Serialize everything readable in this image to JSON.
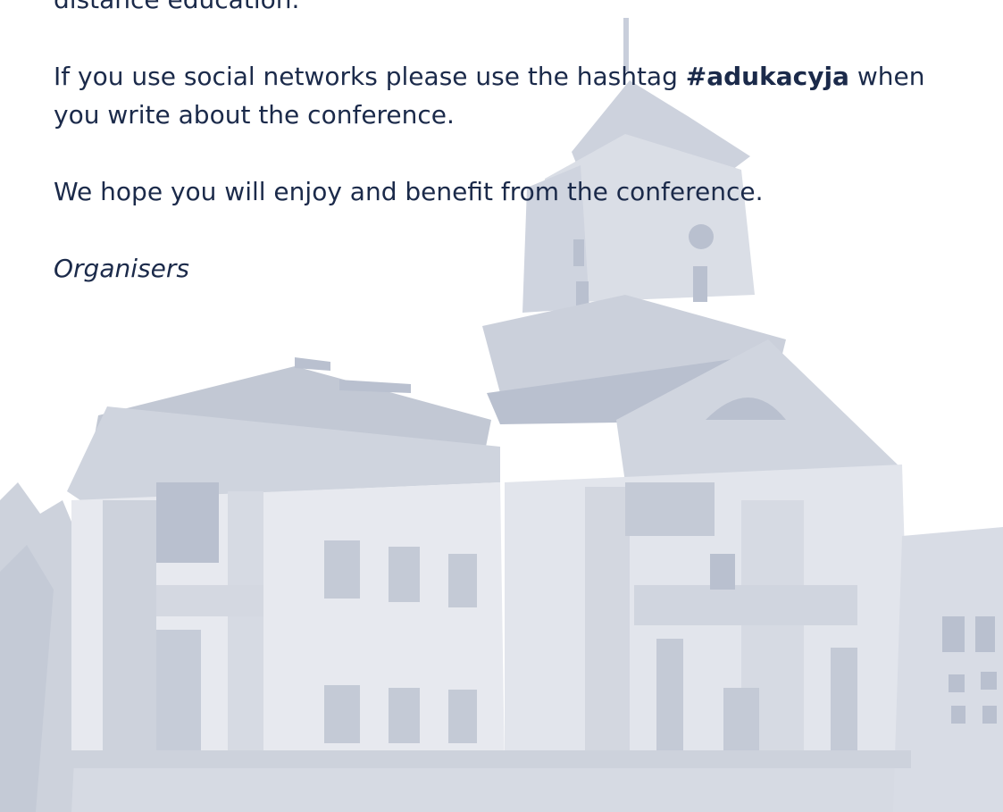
{
  "document": {
    "fragment_top": "distance education.",
    "para_social_before": "If you use social networks please use the hashtag ",
    "para_social_hashtag": "#adukacyja",
    "para_social_after": " when you write about the conference.",
    "para_hope": "We hope you will enjoy and benefit from the conference.",
    "signature": "Organisers"
  },
  "colors": {
    "text": "#1b2a4a",
    "building": "#cfd4df",
    "building_dark": "#b9c0cf",
    "background": "#ffffff"
  }
}
